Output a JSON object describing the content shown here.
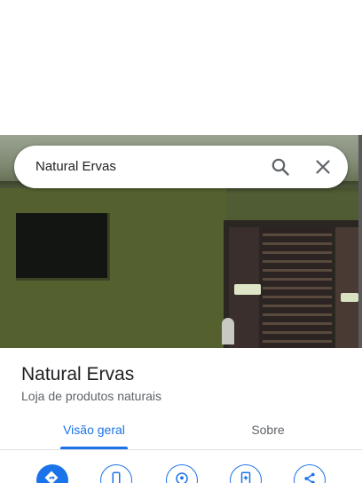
{
  "search": {
    "query": "Natural Ervas"
  },
  "place": {
    "name": "Natural Ervas",
    "category": "Loja de produtos naturais"
  },
  "tabs": [
    {
      "label": "Visão geral",
      "selected": true
    },
    {
      "label": "Sobre",
      "selected": false
    }
  ],
  "actions": [
    {
      "icon": "directions-icon"
    },
    {
      "icon": "phone-icon"
    },
    {
      "icon": "location-pin-icon"
    },
    {
      "icon": "save-icon"
    },
    {
      "icon": "share-icon"
    }
  ],
  "colors": {
    "accent": "#1a73e8",
    "text_primary": "#202124",
    "text_secondary": "#5f6368"
  }
}
